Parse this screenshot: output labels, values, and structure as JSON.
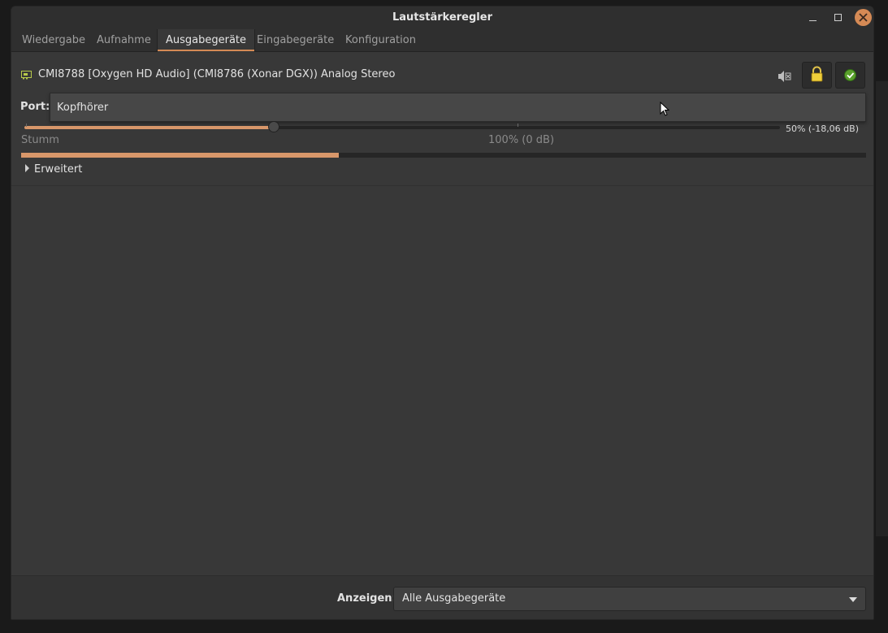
{
  "window": {
    "title": "Lautstärkeregler"
  },
  "tabs": [
    {
      "label": "Wiedergabe"
    },
    {
      "label": "Aufnahme"
    },
    {
      "label": "Ausgabegeräte"
    },
    {
      "label": "Eingabegeräte"
    },
    {
      "label": "Konfiguration"
    }
  ],
  "active_tab": "Ausgabegeräte",
  "device": {
    "name": "CMI8788 [Oxygen HD Audio] (CMI8786 (Xonar DGX)) Analog Stereo",
    "port_label": "Port:",
    "port_value": "Kopfhörer",
    "volume_fraction": 0.33,
    "volume_readout": "50% (-18,06 dB)",
    "mark_mute": "Stumm",
    "mark_100": "100% (0 dB)",
    "peak_fraction": 0.376,
    "advanced_label": "Erweitert"
  },
  "footer": {
    "show_label": "Anzeigen:",
    "show_value": "Alle Ausgabegeräte"
  },
  "colors": {
    "accent": "#d8976a",
    "close_button": "#d58a55"
  },
  "icons": [
    "minimize-icon",
    "maximize-icon",
    "close-icon",
    "sound-card-icon",
    "mute-speaker-icon",
    "lock-icon",
    "checkmark-icon",
    "expander-arrow-icon",
    "dropdown-caret-icon",
    "mouse-cursor-icon"
  ]
}
